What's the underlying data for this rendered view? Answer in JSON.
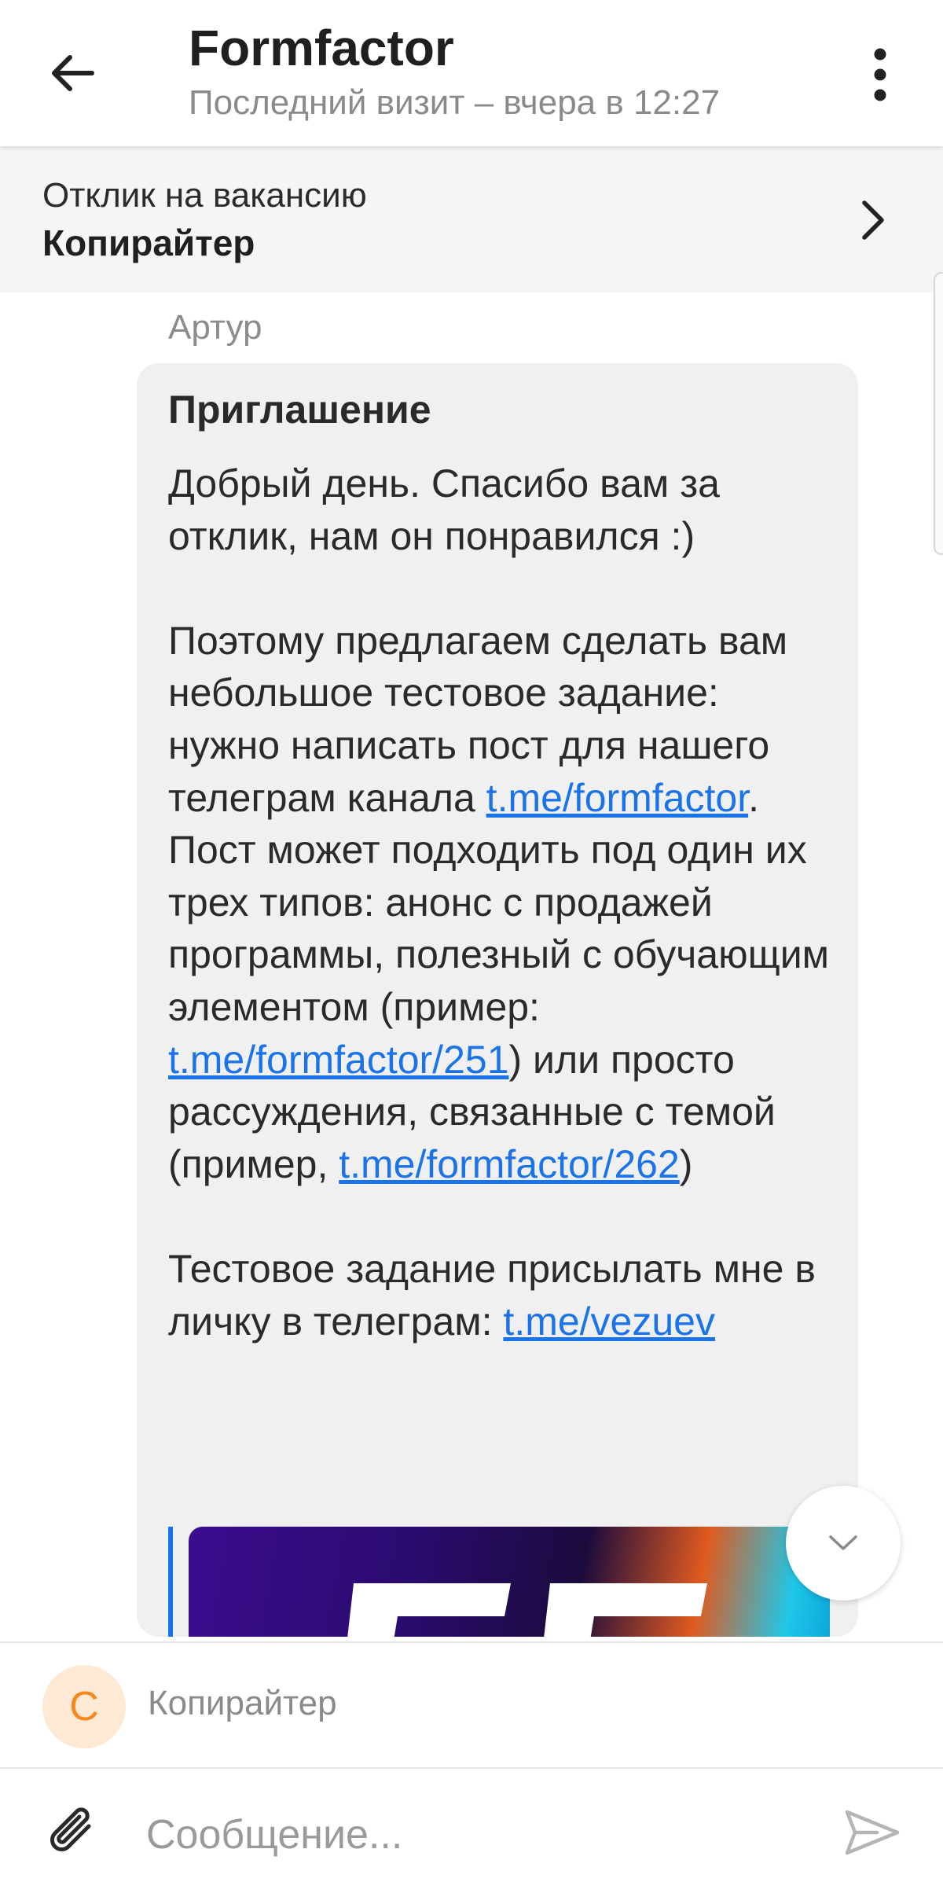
{
  "header": {
    "title": "Formfactor",
    "subtitle": "Последний визит – вчера в 12:27"
  },
  "vacancy": {
    "label": "Отклик на вакансию",
    "name": "Копирайтер"
  },
  "message": {
    "sender": "Артур",
    "title": "Приглашение",
    "p1": "Добрый день. Спасибо вам за отклик, нам он понравился :)",
    "p2_a": "Поэтому предлагаем сделать вам небольшое тестовое задание: нужно написать пост для нашего телеграм канала ",
    "link1": "t.me/formfactor",
    "p2_b": ". Пост может подходить под один их трех типов: анонс с продажей программы, полезный с обучающим элементом (пример: ",
    "link2": "t.me/formfactor/251",
    "p2_c": ") или просто рассуждения, связанные с темой (пример, ",
    "link3": "t.me/formfactor/262",
    "p2_d": ")",
    "p3_a": "Тестовое задание присылать мне в личку в телеграм: ",
    "link4": "t.me/vezuev"
  },
  "chip": {
    "avatar_letter": "С",
    "label": "Копирайтер"
  },
  "composer": {
    "placeholder": "Сообщение..."
  },
  "icons": {
    "back": "arrow-left-icon",
    "menu": "more-vertical-icon",
    "vacancy_chevron": "chevron-right-icon",
    "scroll_down": "chevron-down-icon",
    "attach": "paperclip-icon",
    "send": "send-icon"
  },
  "colors": {
    "link": "#1a73e8",
    "avatar_bg": "#fde9d4",
    "avatar_fg": "#f5891f",
    "bubble": "#f0f0f0",
    "banner": "#f5f5f5"
  }
}
